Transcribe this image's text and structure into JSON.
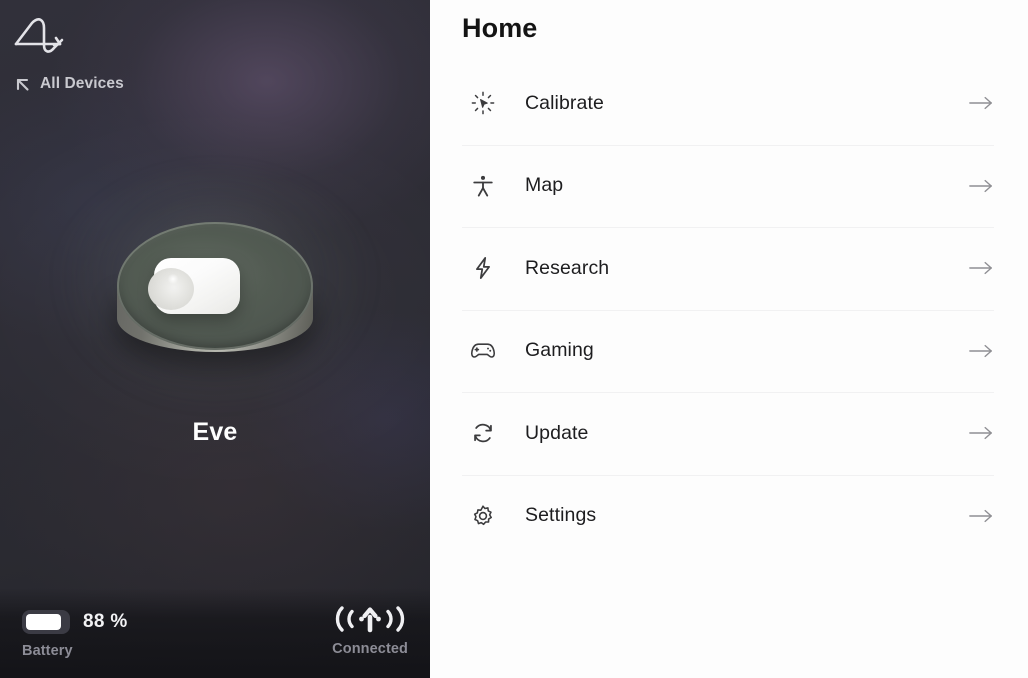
{
  "device_panel": {
    "logo_icon": "waveform-logo-icon",
    "back": {
      "icon": "back-arrow-icon",
      "label": "All Devices"
    },
    "device": {
      "name": "Eve",
      "render_icon": "device-render"
    },
    "status": {
      "battery": {
        "icon": "battery-icon",
        "value": "88 %",
        "percent": 88,
        "caption": "Battery"
      },
      "connection": {
        "icon": "wireless-signal-icon",
        "caption": "Connected"
      }
    }
  },
  "menu_panel": {
    "title": "Home",
    "items": [
      {
        "label": "Calibrate",
        "icon": "calibrate-cursor-icon",
        "chevron": "arrow-right-icon"
      },
      {
        "label": "Map",
        "icon": "accessibility-person-icon",
        "chevron": "arrow-right-icon"
      },
      {
        "label": "Research",
        "icon": "lightning-bolt-icon",
        "chevron": "arrow-right-icon"
      },
      {
        "label": "Gaming",
        "icon": "gamepad-icon",
        "chevron": "arrow-right-icon"
      },
      {
        "label": "Update",
        "icon": "refresh-sync-icon",
        "chevron": "arrow-right-icon"
      },
      {
        "label": "Settings",
        "icon": "gear-icon",
        "chevron": "arrow-right-icon"
      }
    ]
  },
  "colors": {
    "panel_background": "#2e2d36",
    "menu_background": "#fdfdfd",
    "text_primary": "#1d1d1f",
    "text_muted": "#8c8c96",
    "divider": "#f1f1f2"
  }
}
